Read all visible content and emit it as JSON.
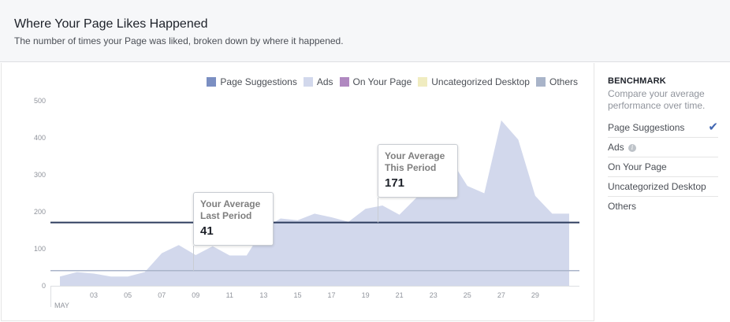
{
  "header": {
    "title": "Where Your Page Likes Happened",
    "subtitle": "The number of times your Page was liked, broken down by where it happened."
  },
  "legend": [
    {
      "label": "Page Suggestions",
      "color": "#7b8fc2"
    },
    {
      "label": "Ads",
      "color": "#d2d8ec"
    },
    {
      "label": "On Your Page",
      "color": "#b088c0"
    },
    {
      "label": "Uncategorized Desktop",
      "color": "#f0ecc0"
    },
    {
      "label": "Others",
      "color": "#a9b4c9"
    }
  ],
  "tooltips": {
    "last": {
      "line1": "Your Average",
      "line2": "Last Period",
      "value": "41"
    },
    "this": {
      "line1": "Your Average",
      "line2": "This Period",
      "value": "171"
    }
  },
  "benchmark": {
    "title": "BENCHMARK",
    "description": "Compare your average performance over time.",
    "items": [
      {
        "label": "Page Suggestions",
        "selected": true
      },
      {
        "label": "Ads",
        "info": true
      },
      {
        "label": "On Your Page"
      },
      {
        "label": "Uncategorized Desktop"
      },
      {
        "label": "Others"
      }
    ]
  },
  "chart_data": {
    "type": "area",
    "title": "",
    "xlabel": "",
    "ylabel": "",
    "x_month_label": "MAY",
    "ylim": [
      0,
      500
    ],
    "yticks": [
      0,
      100,
      200,
      300,
      400,
      500
    ],
    "xlim": [
      1,
      31
    ],
    "xticks": [
      "03",
      "05",
      "07",
      "09",
      "11",
      "13",
      "15",
      "17",
      "19",
      "21",
      "23",
      "25",
      "27",
      "29"
    ],
    "series": [
      {
        "name": "Ads",
        "color": "#d2d8ec",
        "x": [
          1,
          2,
          3,
          4,
          5,
          6,
          7,
          8,
          9,
          10,
          11,
          12,
          13,
          14,
          15,
          16,
          17,
          18,
          19,
          20,
          21,
          22,
          23,
          24,
          25,
          26,
          27,
          28,
          29,
          30,
          31
        ],
        "values": [
          25,
          37,
          33,
          25,
          25,
          37,
          88,
          110,
          83,
          107,
          82,
          82,
          155,
          182,
          177,
          195,
          185,
          173,
          208,
          217,
          192,
          238,
          365,
          343,
          270,
          250,
          447,
          395,
          243,
          195,
          195
        ]
      }
    ],
    "reference_lines": [
      {
        "label": "Your Average This Period",
        "value": 171,
        "color": "#2d3c5e"
      },
      {
        "label": "Your Average Last Period",
        "value": 41,
        "color": "#a9b4c9"
      }
    ]
  }
}
